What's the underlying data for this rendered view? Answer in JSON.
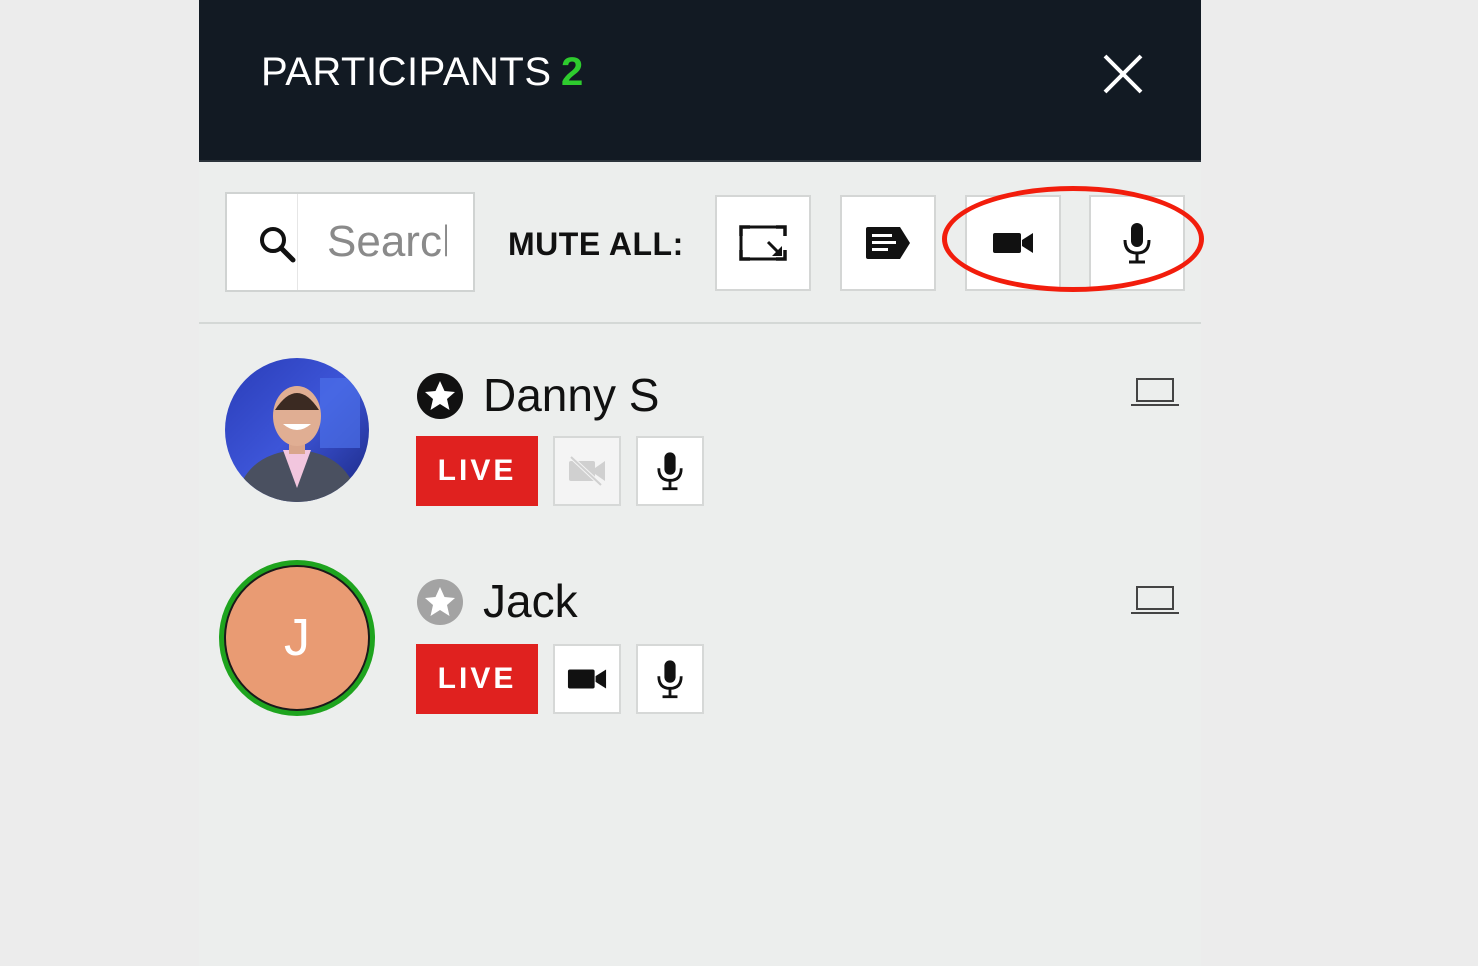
{
  "header": {
    "title": "PARTICIPANTS",
    "count": "2",
    "count_color": "#2ecc2e",
    "close_icon": "close-icon"
  },
  "toolbar": {
    "search_placeholder": "Search",
    "search_icon": "search-icon",
    "mute_all_label": "MUTE ALL:",
    "buttons": [
      {
        "name": "screen-share-button",
        "icon": "screen-resize-icon"
      },
      {
        "name": "chat-button",
        "icon": "chat-icon"
      },
      {
        "name": "mute-all-video-button",
        "icon": "video-camera-icon"
      },
      {
        "name": "mute-all-audio-button",
        "icon": "microphone-icon"
      }
    ],
    "highlight_color": "#f21d0c"
  },
  "participants": [
    {
      "name": "Danny S",
      "role_icon": "star-filled-icon",
      "avatar": "photo",
      "live_label": "LIVE",
      "video": "off",
      "audio": "on",
      "device_icon": "laptop-icon"
    },
    {
      "name": "Jack",
      "role_icon": "star-outline-icon",
      "avatar_initial": "J",
      "avatar_color": "#e99b73",
      "live_label": "LIVE",
      "video": "on",
      "audio": "on",
      "device_icon": "laptop-icon"
    }
  ]
}
